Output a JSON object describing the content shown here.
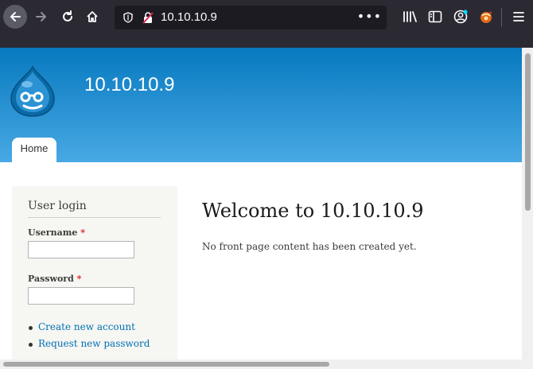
{
  "browser": {
    "url": "10.10.10.9",
    "page_actions": "•••"
  },
  "site": {
    "name": "10.10.10.9",
    "tabs": [
      {
        "label": "Home"
      }
    ]
  },
  "login_block": {
    "title": "User login",
    "username_label": "Username",
    "password_label": "Password",
    "required_marker": "*",
    "links": [
      {
        "label": "Create new account"
      },
      {
        "label": "Request new password"
      }
    ]
  },
  "main": {
    "title": "Welcome to 10.10.10.9",
    "message": "No front page content has been created yet."
  },
  "colors": {
    "header_top": "#0779bf",
    "header_bottom": "#48a9e4",
    "link": "#0071b3",
    "required": "#e02020"
  },
  "icons": [
    "back-arrow-icon",
    "forward-arrow-icon",
    "reload-icon",
    "home-icon",
    "shield-icon",
    "insecure-lock-icon",
    "library-icon",
    "sidebar-icon",
    "account-icon",
    "extension-icon",
    "hamburger-menu-icon",
    "drupal-logo"
  ]
}
